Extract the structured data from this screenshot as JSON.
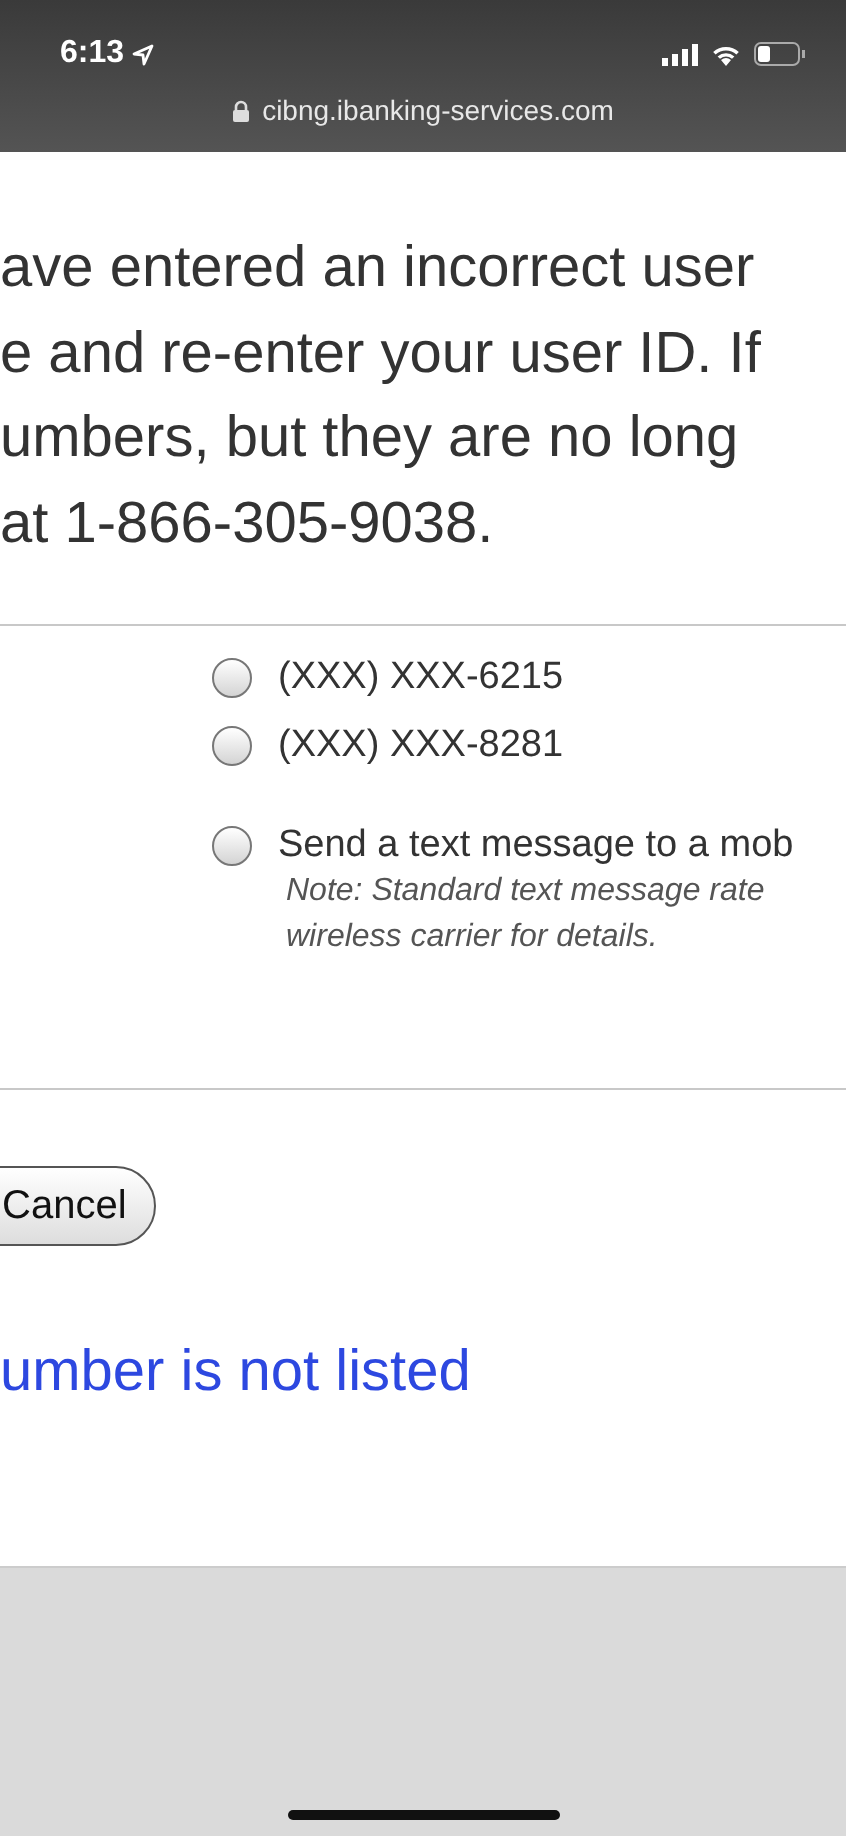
{
  "status_bar": {
    "time": "6:13"
  },
  "address_bar": {
    "url": "cibng.ibanking-services.com"
  },
  "message_lines": [
    "ave entered an incorrect user",
    "e and re-enter your user ID. If",
    "umbers, but they are no long",
    "at 1-866-305-9038."
  ],
  "phone_options": [
    {
      "label": "(XXX) XXX-6215",
      "selected": false
    },
    {
      "label": "(XXX) XXX-8281",
      "selected": false
    }
  ],
  "text_option": {
    "label": "Send a text message to a mob",
    "selected": false,
    "note_lines": [
      "Note: Standard text message rate",
      "wireless carrier for details."
    ]
  },
  "cancel_button": "Cancel",
  "link": "umber is not listed"
}
